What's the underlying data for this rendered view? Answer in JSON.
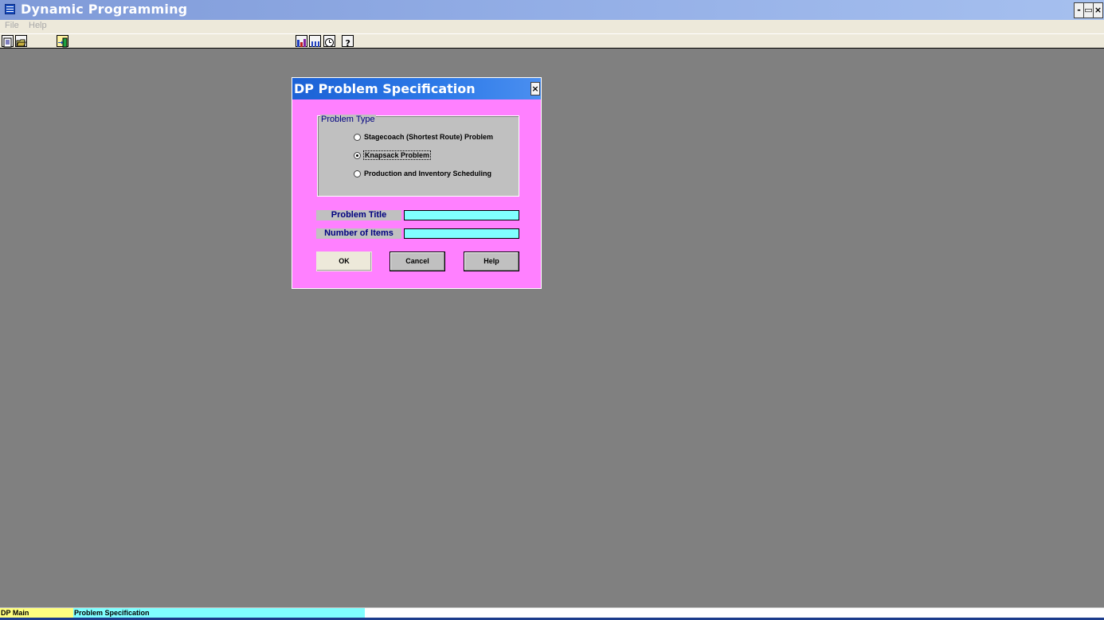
{
  "window": {
    "title": "Dynamic Programming",
    "icon": "app-window-icon",
    "controls": [
      "-",
      "▭",
      "×"
    ]
  },
  "menu": {
    "items": [
      {
        "label": "File"
      },
      {
        "label": "Help"
      }
    ]
  },
  "toolbar": {
    "buttons": [
      {
        "icon": "new-document-icon"
      },
      {
        "icon": "open-folder-icon"
      },
      {
        "icon": "exit-icon"
      },
      {
        "icon": "bar-chart-icon"
      },
      {
        "icon": "table-icon"
      },
      {
        "icon": "clock-icon"
      },
      {
        "icon": "help-question-icon"
      }
    ]
  },
  "dialog": {
    "title": "DP Problem Specification",
    "close_label": "×",
    "problem_type": {
      "label": "Problem Type",
      "options": [
        {
          "label": "Stagecoach (Shortest Route) Problem",
          "selected": false
        },
        {
          "label": "Knapsack Problem",
          "selected": true
        },
        {
          "label": "Production and Inventory Scheduling",
          "selected": false
        }
      ]
    },
    "fields": {
      "problem_title": {
        "label": "Problem Title",
        "value": ""
      },
      "number_of_items": {
        "label": "Number of Items",
        "value": ""
      }
    },
    "buttons": {
      "ok": "OK",
      "cancel": "Cancel",
      "help": "Help"
    }
  },
  "status": {
    "main": "DP Main",
    "current": "Problem Specification",
    "colors": {
      "main": "#ffff80",
      "current": "#80ffff"
    }
  },
  "colors": {
    "desktop": "#808080",
    "dialog_background": "#ff80ff",
    "input_background": "#80ffff",
    "label_text": "#000080"
  }
}
